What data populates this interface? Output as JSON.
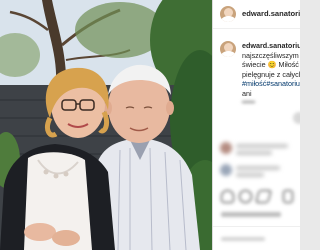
{
  "post": {
    "username": "edward.sanatorium",
    "caption": {
      "username": "edward.sanatorium",
      "line1": "najszczęśliwszym cz",
      "line2a": "świecie ",
      "line2_emoji": "😊",
      "line2b": " Miłość k",
      "line3": "pielęgnuje z całych",
      "line4": "#miłość#sanatorium",
      "line5": "ani"
    }
  },
  "icons": {
    "user_avatar": "avatar",
    "caption_avatar": "avatar",
    "like": "heart-icon",
    "comment": "comment-icon",
    "share": "share-icon",
    "save": "bookmark-icon"
  },
  "colors": {
    "panel_bg": "#ffffff",
    "text": "#262626",
    "hashtag": "#00376b",
    "muted": "#8e8e8e"
  }
}
